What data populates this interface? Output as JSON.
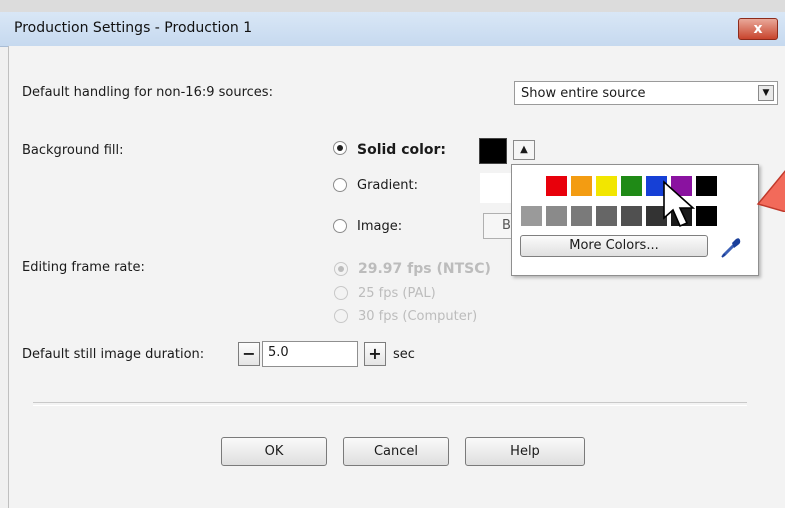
{
  "window": {
    "title": "Production Settings - Production 1",
    "close_label": "x"
  },
  "fields": {
    "nonwide_label": "Default handling for non-16:9 sources:",
    "nonwide_value": "Show entire source",
    "bgfill_label": "Background fill:",
    "solid_label": "Solid color:",
    "gradient_label": "Gradient:",
    "image_label": "Image:",
    "browse_partial": "B",
    "framerate_label": "Editing frame rate:",
    "fps_options": [
      "29.97 fps (NTSC)",
      "25 fps (PAL)",
      "30 fps (Computer)"
    ],
    "still_label": "Default still image duration:",
    "still_value": "5.0",
    "still_unit": "sec",
    "minus": "−",
    "plus": "+"
  },
  "color_popup": {
    "row1": [
      "#ffffff",
      "#e8000b",
      "#f39c12",
      "#f2e600",
      "#1f8a16",
      "#1640d6",
      "#8a12a0",
      "#000000"
    ],
    "row2": [
      "#9a9a9a",
      "#8a8a8a",
      "#7a7a7a",
      "#666666",
      "#505050",
      "#333333",
      "#1a1a1a",
      "#000000"
    ],
    "more_colors_label": "More Colors...",
    "selected": "#000000"
  },
  "buttons": {
    "ok": "OK",
    "cancel": "Cancel",
    "help": "Help"
  },
  "icons": {
    "dropdown": "triangle-down",
    "popup_toggle": "triangle-up",
    "eyedropper": "eyedropper",
    "cursor": "mouse-pointer",
    "annotation": "red-arrow"
  }
}
